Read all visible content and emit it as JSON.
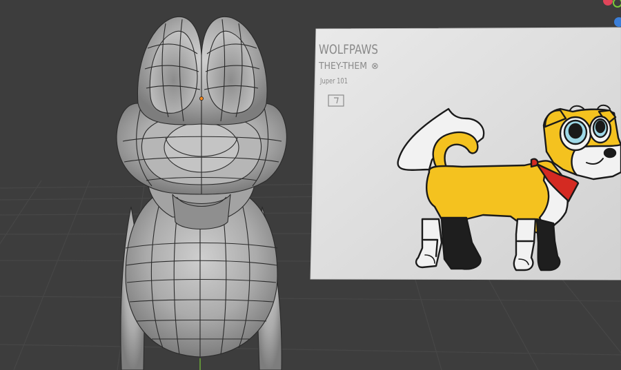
{
  "reference": {
    "name_line": "WOLFPAWS",
    "pronoun_line": "THEY-THEM",
    "pronoun_mark": "⊗",
    "info_line": "Juper 101"
  },
  "colors": {
    "viewport_bg": "#3d3d3d",
    "grid_line": "#474747",
    "paper": "#dcdcdc",
    "dog_yellow": "#f4c21f",
    "bandana_red": "#d42a22",
    "eye_blue": "#9fd9e8",
    "mesh_gray": "#a9a9a9",
    "wire_dark": "#2a2a2a",
    "axis_x": "#e0455a",
    "axis_y": "#7ac93a",
    "axis_z": "#3b7fd9",
    "origin_dot": "#ff8a1c"
  },
  "icons": {
    "gizmo_x": "x-axis-icon",
    "gizmo_y": "y-axis-icon",
    "gizmo_z": "z-axis-icon",
    "origin": "object-origin-icon"
  }
}
